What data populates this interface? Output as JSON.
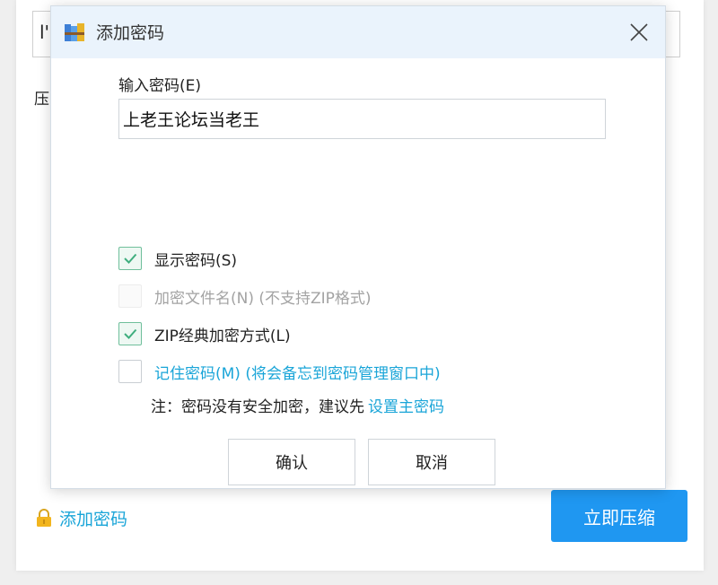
{
  "background": {
    "input_fragment_left": "l'",
    "input_fragment_right": "i",
    "side_label": "压",
    "add_password_label": "添加密码",
    "compress_button_label": "立即压缩"
  },
  "dialog": {
    "title": "添加密码",
    "password_label": "输入密码(E)",
    "password_value": "上老王论坛当老王",
    "options": [
      {
        "label": "显示密码(S)",
        "checked": true,
        "disabled": false
      },
      {
        "label": "加密文件名(N) (不支持ZIP格式)",
        "checked": false,
        "disabled": true
      },
      {
        "label": "ZIP经典加密方式(L)",
        "checked": true,
        "disabled": false
      },
      {
        "label": "记住密码(M) (将会备忘到密码管理窗口中)",
        "checked": false,
        "disabled": false
      }
    ],
    "note_text": "注：密码没有安全加密，建议先",
    "note_link": "设置主密码",
    "confirm_label": "确认",
    "cancel_label": "取消"
  },
  "colors": {
    "accent": "#1aa5d8",
    "primary_button": "#1f97f1",
    "titlebar": "#eaf3fc",
    "check": "#3fae7e"
  },
  "icons": {
    "title": "winrar-archive-icon",
    "close": "close-icon",
    "lock": "lock-icon",
    "check": "checkmark-icon"
  }
}
